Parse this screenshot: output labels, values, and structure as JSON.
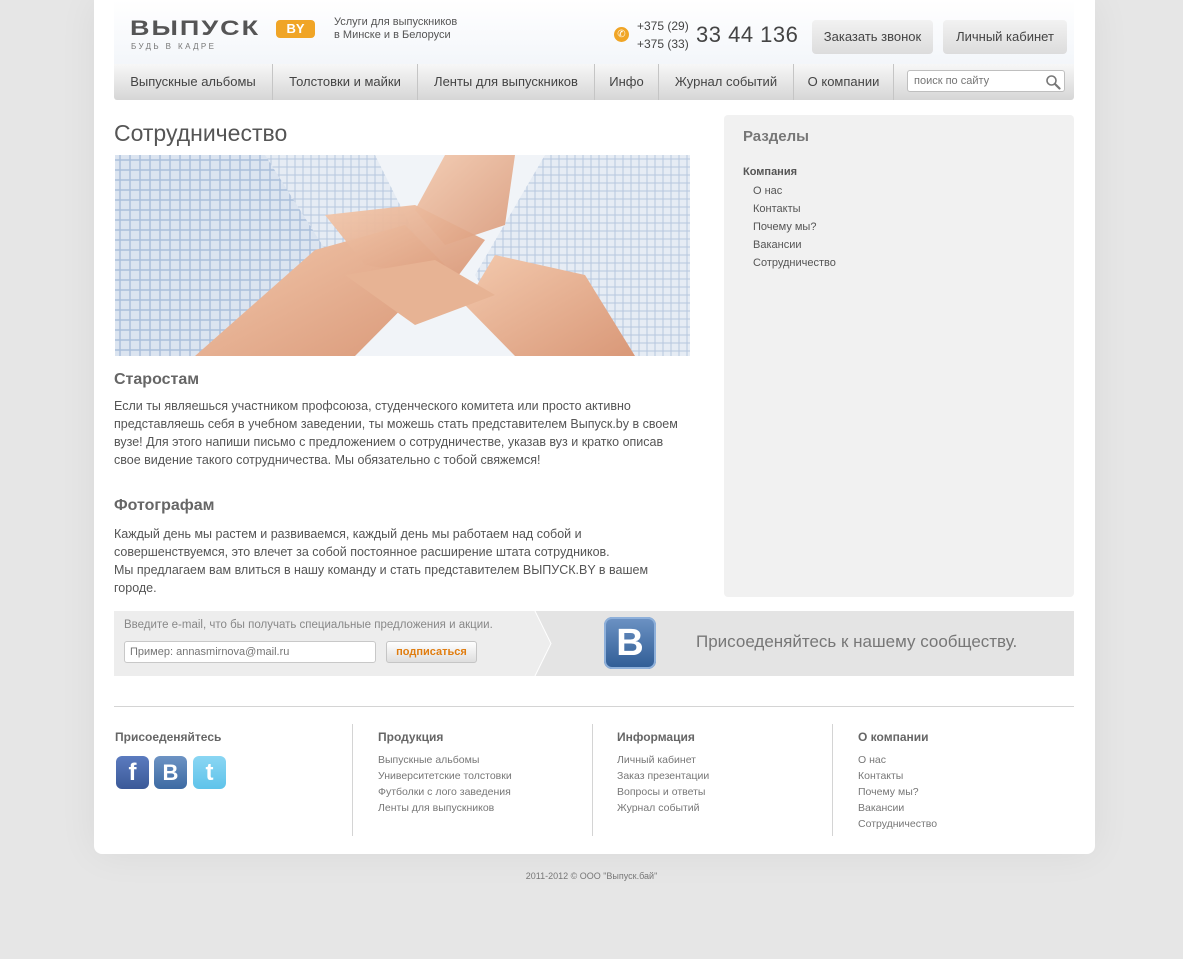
{
  "header": {
    "logo_text": "ВЫПУСК",
    "logo_badge": "BY",
    "tagline": "БУДЬ В КАДРЕ",
    "slogan_line1": "Услуги для выпускников",
    "slogan_line2": "в Минске и в Белоруси",
    "phone_code1": "+375 (29)",
    "phone_code2": "+375 (33)",
    "phone_number": "33 44 136",
    "call_button": "Заказать звонок",
    "cabinet_button": "Личный кабинет"
  },
  "nav": {
    "items": [
      {
        "label": "Выпускные альбомы"
      },
      {
        "label": "Толстовки и майки"
      },
      {
        "label": "Ленты для выпускников"
      },
      {
        "label": "Инфо"
      },
      {
        "label": "Журнал событий"
      },
      {
        "label": "О компании"
      }
    ],
    "search_placeholder": "поиск по сайту"
  },
  "main": {
    "title": "Сотрудничество",
    "section1_title": "Старостам",
    "section1_text": "Если ты являешься участником профсоюза, студенческого комитета или просто активно представляешь себя в учебном заведении, ты можешь стать представителем Выпуск.by в своем вузе!  Для этого напиши письмо с предложением о сотрудничестве, указав вуз и кратко описав свое видение такого сотрудничества. Мы обязательно с тобой свяжемся!",
    "section2_title": "Фотографам",
    "section2_text1": "Каждый день мы растем и развиваемся, каждый день мы работаем над собой и совершенствуемся, это влечет за собой постоянное расширение штата сотрудников.",
    "section2_text2": "Мы предлагаем вам влиться в нашу команду и стать представителем ВЫПУСК.BY в вашем городе."
  },
  "sidebar": {
    "title": "Разделы",
    "group": "Компания",
    "links": [
      {
        "label": "О нас"
      },
      {
        "label": "Контакты"
      },
      {
        "label": "Почему мы?"
      },
      {
        "label": "Вакансии"
      },
      {
        "label": "Сотрудничество"
      }
    ]
  },
  "subscribe": {
    "hint": "Введите e-mail, что бы получать специальные предложения и акции.",
    "placeholder": "Пример: annasmirnova@mail.ru",
    "button": "подписаться",
    "community_text": "Присоеденяйтесь к нашему сообществу."
  },
  "footer": {
    "join_title": "Присоеденяйтесь",
    "columns": [
      {
        "title": "Продукция",
        "links": [
          "Выпускные альбомы",
          "Университетские толстовки",
          "Футболки с лого заведения",
          "Ленты для выпускников"
        ]
      },
      {
        "title": "Информация",
        "links": [
          "Личный кабинет",
          "Заказ презентации",
          "Вопросы и ответы",
          "Журнал событий"
        ]
      },
      {
        "title": "О компании",
        "links": [
          "О нас",
          "Контакты",
          "Почему мы?",
          "Вакансии",
          "Сотрудничество"
        ]
      }
    ],
    "copyright": "2011-2012  ©  ООО \"Выпуск.бай\""
  },
  "colors": {
    "accent": "#f0a526",
    "vk_blue": "#3d6aa3",
    "facebook_blue": "#3b5998",
    "twitter_blue": "#5fc3ea"
  },
  "icons": {
    "phone": "phone-icon",
    "search": "search-icon",
    "vk": "vk-icon",
    "facebook": "facebook-icon",
    "twitter": "twitter-icon"
  }
}
